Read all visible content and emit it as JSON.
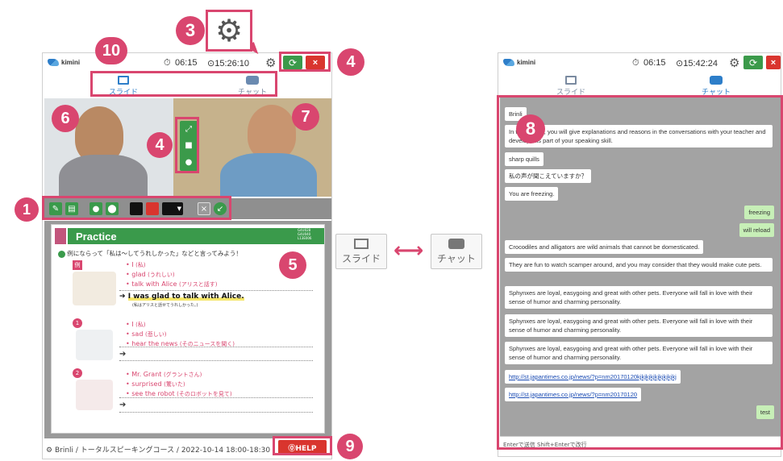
{
  "left_window": {
    "logo": "kimini",
    "timer": "06:15",
    "clock": "⊙15:26:10",
    "tabs": {
      "slide": "スライド",
      "chat": "チャット"
    },
    "footer": "Brinli / トータルスピーキングコース / 2022-10-14 18:00-18:30",
    "help_label": "⓪HELP",
    "slide": {
      "title": "Practice",
      "instruction": "例にならって「私は～してうれしかった」などと言ってみよう！",
      "badge": "例",
      "example": {
        "l1": "• I",
        "l1jp": "(私)",
        "l2": "• glad",
        "l2jp": "(うれしい)",
        "l3": "• talk with Alice",
        "l3jp": "(アリスと話す)",
        "answer": "I was glad to talk with Alice.",
        "answer_jp": "(私はアリスと話せてうれしかった。)"
      },
      "item1": {
        "l1": "• I",
        "l1jp": "(私)",
        "l2": "• sad",
        "l2jp": "(悲しい)",
        "l3": "• hear the news",
        "l3jp": "(そのニュースを聞く)"
      },
      "item2": {
        "l1": "• Mr. Grant",
        "l1jp": "(グラントさん)",
        "l2": "• surprised",
        "l2jp": "(驚いた)",
        "l3": "• see the robot",
        "l3jp": "(そのロボットを見て)"
      },
      "corner_code": "G4U028 G4U040 L13E006"
    }
  },
  "right_window": {
    "logo": "kimini",
    "timer": "06:15",
    "clock": "⊙15:42:24",
    "tabs": {
      "slide": "スライド",
      "chat": "チャット"
    },
    "messages": [
      {
        "text": "Brinli",
        "me": false
      },
      {
        "text": "In this lesson, you will give explanations and reasons in the conversations with your teacher and develop this part of your speaking skill.",
        "me": false
      },
      {
        "text": "sharp quills",
        "me": false
      },
      {
        "text": "私の声が聞こえていますか？",
        "me": false
      },
      {
        "text": "You are freezing.",
        "me": false
      },
      {
        "text": "freezing",
        "me": true
      },
      {
        "text": "will reload",
        "me": true
      },
      {
        "text": "Crocodiles and alligators are wild animals that cannot be domesticated.",
        "me": false
      },
      {
        "text": "They are fun to watch scamper around, and you may consider that they would make cute pets.",
        "me": false
      },
      {
        "text": "Sphynxes are loyal, easygoing and great with other pets. Everyone will fall in love with their sense of humor and charming personality.",
        "me": false
      },
      {
        "text": "Sphynxes are loyal, easygoing and great with other pets. Everyone will fall in love with their sense of humor and charming personality.",
        "me": false
      },
      {
        "text": "Sphynxes are loyal, easygoing and great with other pets. Everyone will fall in love with their sense of humor and charming personality.",
        "me": false
      },
      {
        "text": "http://st.japantimes.co.jp/news/?p=nm20170120kjkjkjkjkjkjkjkjkj",
        "me": false,
        "link": true
      },
      {
        "text": "http://st.japantimes.co.jp/news/?p=nm20170120",
        "me": false,
        "link": true
      },
      {
        "text": "test",
        "me": true
      }
    ],
    "input_placeholder": "Enterで送信 Shift+Enterで改行"
  },
  "middle": {
    "slide_label": "スライド",
    "chat_label": "チャット",
    "arrow": "⟷"
  },
  "annotations": [
    "1",
    "2",
    "3",
    "4",
    "5",
    "6",
    "7",
    "8",
    "9",
    "10"
  ],
  "colors": {
    "accent": "#d9466f",
    "green": "#3a9a4b",
    "red": "#d9352e",
    "chat_bg": "#a3a3a3"
  }
}
